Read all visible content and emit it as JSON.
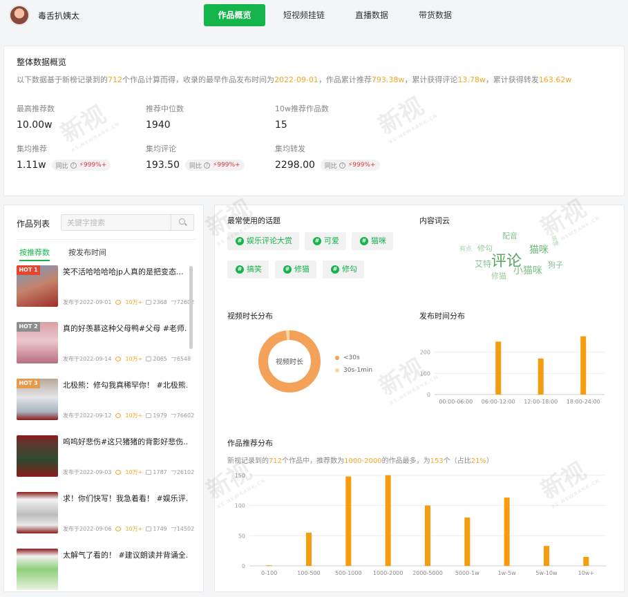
{
  "account": {
    "name": "毒舌扒姨太"
  },
  "tabs": [
    {
      "label": "作品概览",
      "active": true
    },
    {
      "label": "短视频挂链"
    },
    {
      "label": "直播数据"
    },
    {
      "label": "带货数据"
    }
  ],
  "overview": {
    "title": "整体数据概览",
    "desc_pre": "以下数据基于新榜记录到的",
    "desc_count": "712",
    "desc_mid1": "个作品计算而得，收录的最早作品发布时间为",
    "desc_date": "2022-09-01",
    "desc_mid2": "，作品累计推荐",
    "desc_rec": "793.38w",
    "desc_mid3": "，累计获得评论",
    "desc_comment": "13.78w",
    "desc_mid4": "，累计获得转发",
    "desc_share": "163.62w",
    "stats": [
      {
        "label": "最高推荐数",
        "value": "10.00w"
      },
      {
        "label": "推荐中位数",
        "value": "1940"
      },
      {
        "label": "10w推荐作品数",
        "value": "15"
      },
      {
        "label": "集均推荐",
        "value": "1.11w",
        "yoy_label": "同比",
        "yoy": "999%+"
      },
      {
        "label": "集均评论",
        "value": "193.50",
        "yoy_label": "同比",
        "yoy": "999%+"
      },
      {
        "label": "集均转发",
        "value": "2298.00",
        "yoy_label": "同比",
        "yoy": "999%+"
      }
    ]
  },
  "works": {
    "title": "作品列表",
    "search_placeholder": "关键字搜索",
    "sort_tabs": [
      "按推荐数",
      "按发布时间"
    ],
    "items": [
      {
        "hot": "HOT 1",
        "title": "笑不活哈哈哈哈jp人真的是把变态...",
        "date": "发布于2022-09-01",
        "likes": "10万+",
        "comments": "2368",
        "shares": "72602"
      },
      {
        "hot": "HOT 2",
        "title": "真的好羡慕这种父母鸭#父母 #老师...",
        "date": "发布于2022-09-14",
        "likes": "10万+",
        "comments": "2065",
        "shares": "6548"
      },
      {
        "hot": "HOT 3",
        "title": "北极熊：修勾我真稀罕你！ #北极熊...",
        "date": "发布于2022-09-12",
        "likes": "10万+",
        "comments": "1979",
        "shares": "76602"
      },
      {
        "hot": "",
        "title": "呜呜好悲伤#这只猪猪的背影好悲伤...",
        "date": "发布于2022-09-03",
        "likes": "10万+",
        "comments": "1787",
        "shares": "26102"
      },
      {
        "hot": "",
        "title": "求！你们快写！我急着看！ #娱乐评...",
        "date": "发布于2022-09-06",
        "likes": "10万+",
        "comments": "1749",
        "shares": "14502"
      },
      {
        "hot": "",
        "title": "太解气了看的！ #建议朗读并背诵全...",
        "date": "",
        "likes": "",
        "comments": "",
        "shares": ""
      }
    ]
  },
  "topics": {
    "title": "最常使用的话题",
    "items": [
      "娱乐评论大赏",
      "可爱",
      "猫咪",
      "搞笑",
      "修猫",
      "修勾"
    ]
  },
  "wordcloud": {
    "title": "内容词云",
    "words": [
      {
        "text": "评论",
        "size": 22,
        "color": "#5aa763"
      },
      {
        "text": "猫咪",
        "size": 14,
        "color": "#6fb676"
      },
      {
        "text": "小猫咪",
        "size": 14,
        "color": "#7bbf85"
      },
      {
        "text": "配音",
        "size": 11,
        "color": "#8ac392"
      },
      {
        "text": "艾特",
        "size": 12,
        "color": "#8ac392"
      },
      {
        "text": "修勾",
        "size": 11,
        "color": "#9acd9f"
      },
      {
        "text": "狗子",
        "size": 11,
        "color": "#8ac392"
      },
      {
        "text": "修猫",
        "size": 11,
        "color": "#9acd9f"
      },
      {
        "text": "有点",
        "size": 9,
        "color": "#a9d3ad"
      },
      {
        "text": "萌宠",
        "size": 8,
        "color": "#b5d9b8"
      }
    ]
  },
  "duration": {
    "title": "视频时长分布",
    "center": "视频时长",
    "legend": [
      "<30s",
      "30s-1min"
    ],
    "colors": [
      "#f4a15a",
      "#fbd59b"
    ],
    "share": [
      0.98,
      0.02
    ]
  },
  "chart_data": [
    {
      "type": "bar",
      "title": "发布时间分布",
      "categories": [
        "00:00-06:00",
        "06:00-12:00",
        "12:00-18:00",
        "18:00-24:00"
      ],
      "values": [
        0,
        250,
        170,
        275
      ],
      "ylim": [
        0,
        300
      ],
      "yticks": [
        0,
        100,
        200
      ],
      "color": "#f59c0f"
    },
    {
      "type": "bar",
      "title": "作品推荐分布",
      "categories": [
        "0-100",
        "100-500",
        "500-1000",
        "1000-2000",
        "2000-5000",
        "5000-1w",
        "1w-5w",
        "5w-10w",
        "10w+"
      ],
      "values": [
        1,
        55,
        148,
        150,
        100,
        80,
        113,
        33,
        15
      ],
      "ylim": [
        0,
        160
      ],
      "yticks": [
        0,
        50,
        100,
        150
      ],
      "color": "#f59c0f"
    }
  ],
  "recommend_desc": {
    "pre": "新视记录到的",
    "count": "712",
    "mid1": "个作品中，推荐数为",
    "range": "1000-2000",
    "mid2": "的作品最多，为",
    "num": "153",
    "mid3": "个（占比",
    "pct": "21%",
    "end": "）"
  },
  "watermark": {
    "text": "新视",
    "sub": "XS.NEWRANK.CN"
  }
}
